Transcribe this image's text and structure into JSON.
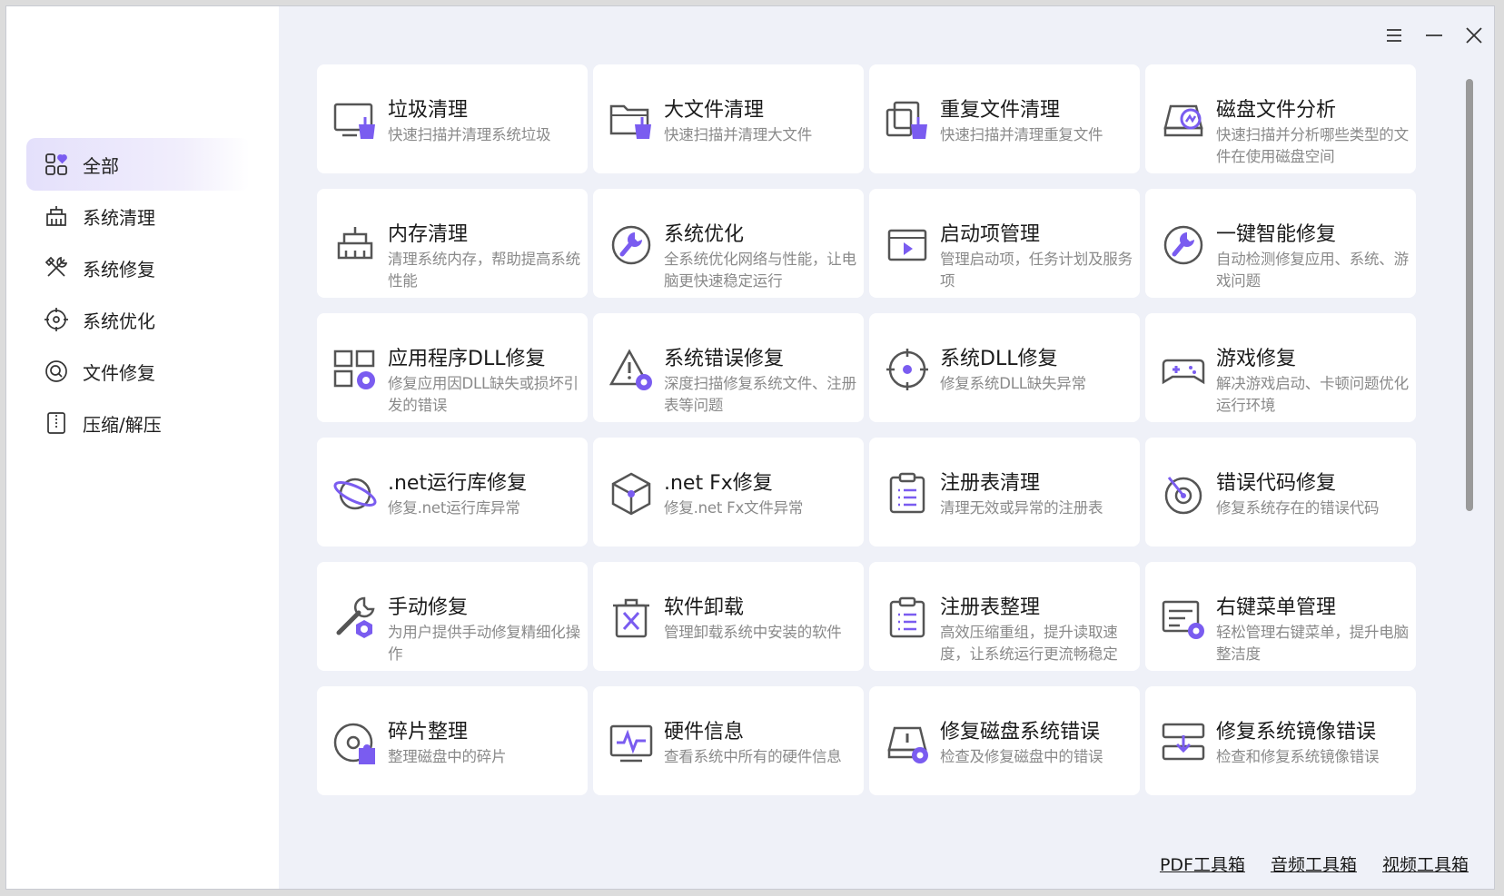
{
  "colors": {
    "accent": "#7a5cf0",
    "icon_gray": "#555555",
    "bg": "#eff1f8"
  },
  "sidebar": {
    "items": [
      {
        "label": "全部",
        "icon": "grid-heart-icon",
        "active": true
      },
      {
        "label": "系统清理",
        "icon": "broom-icon",
        "active": false
      },
      {
        "label": "系统修复",
        "icon": "wrench-cross-icon",
        "active": false
      },
      {
        "label": "系统优化",
        "icon": "target-icon",
        "active": false
      },
      {
        "label": "文件修复",
        "icon": "search-wrench-icon",
        "active": false
      },
      {
        "label": "压缩/解压",
        "icon": "zip-icon",
        "active": false
      }
    ]
  },
  "window_controls": [
    "menu-icon",
    "minimize-icon",
    "close-icon"
  ],
  "tools": [
    {
      "title": "垃圾清理",
      "desc": "快速扫描并清理系统垃圾",
      "icon": "monitor-broom-icon"
    },
    {
      "title": "大文件清理",
      "desc": "快速扫描并清理大文件",
      "icon": "folder-broom-icon"
    },
    {
      "title": "重复文件清理",
      "desc": "快速扫描并清理重复文件",
      "icon": "files-broom-icon"
    },
    {
      "title": "磁盘文件分析",
      "desc": "快速扫描并分析哪些类型的文件在使用磁盘空间",
      "icon": "disk-chart-icon"
    },
    {
      "title": "内存清理",
      "desc": "清理系统内存，帮助提高系统性能",
      "icon": "memory-broom-icon"
    },
    {
      "title": "系统优化",
      "desc": "全系统优化网络与性能，让电脑更快速稳定运行",
      "icon": "wrench-circle-icon"
    },
    {
      "title": "启动项管理",
      "desc": "管理启动项，任务计划及服务项",
      "icon": "play-window-icon"
    },
    {
      "title": "一键智能修复",
      "desc": "自动检测修复应用、系统、游戏问题",
      "icon": "wrench-circle-icon"
    },
    {
      "title": "应用程序DLL修复",
      "desc": "修复应用因DLL缺失或损坏引发的错误",
      "icon": "apps-repair-icon"
    },
    {
      "title": "系统错误修复",
      "desc": "深度扫描修复系统文件、注册表等问题",
      "icon": "warning-repair-icon"
    },
    {
      "title": "系统DLL修复",
      "desc": "修复系统DLL缺失异常",
      "icon": "crosshair-icon"
    },
    {
      "title": "游戏修复",
      "desc": "解决游戏启动、卡顿问题优化运行环境",
      "icon": "gamepad-icon"
    },
    {
      "title": ".net运行库修复",
      "desc": "修复.net运行库异常",
      "icon": "planet-icon"
    },
    {
      "title": ".net Fx修复",
      "desc": "修复.net Fx文件异常",
      "icon": "cube-icon"
    },
    {
      "title": "注册表清理",
      "desc": "清理无效或异常的注册表",
      "icon": "clipboard-list-icon"
    },
    {
      "title": "错误代码修复",
      "desc": "修复系统存在的错误代码",
      "icon": "dial-icon"
    },
    {
      "title": "手动修复",
      "desc": "为用户提供手动修复精细化操作",
      "icon": "wrench-gear-icon"
    },
    {
      "title": "软件卸载",
      "desc": "管理卸载系统中安装的软件",
      "icon": "trash-x-icon"
    },
    {
      "title": "注册表整理",
      "desc": "高效压缩重组，提升读取速度，让系统运行更流畅稳定",
      "icon": "clipboard-list-icon"
    },
    {
      "title": "右键菜单管理",
      "desc": "轻松管理右键菜单，提升电脑整洁度",
      "icon": "menu-repair-icon"
    },
    {
      "title": "碎片整理",
      "desc": "整理磁盘中的碎片",
      "icon": "disc-puzzle-icon"
    },
    {
      "title": "硬件信息",
      "desc": "查看系统中所有的硬件信息",
      "icon": "monitor-pulse-icon"
    },
    {
      "title": "修复磁盘系统错误",
      "desc": "检查及修复磁盘中的错误",
      "icon": "disk-warning-icon"
    },
    {
      "title": "修复系统镜像错误",
      "desc": "检查和修复系统镜像错误",
      "icon": "image-download-icon"
    }
  ],
  "footer": {
    "links": [
      "PDF工具箱",
      "音频工具箱",
      "视频工具箱"
    ]
  }
}
